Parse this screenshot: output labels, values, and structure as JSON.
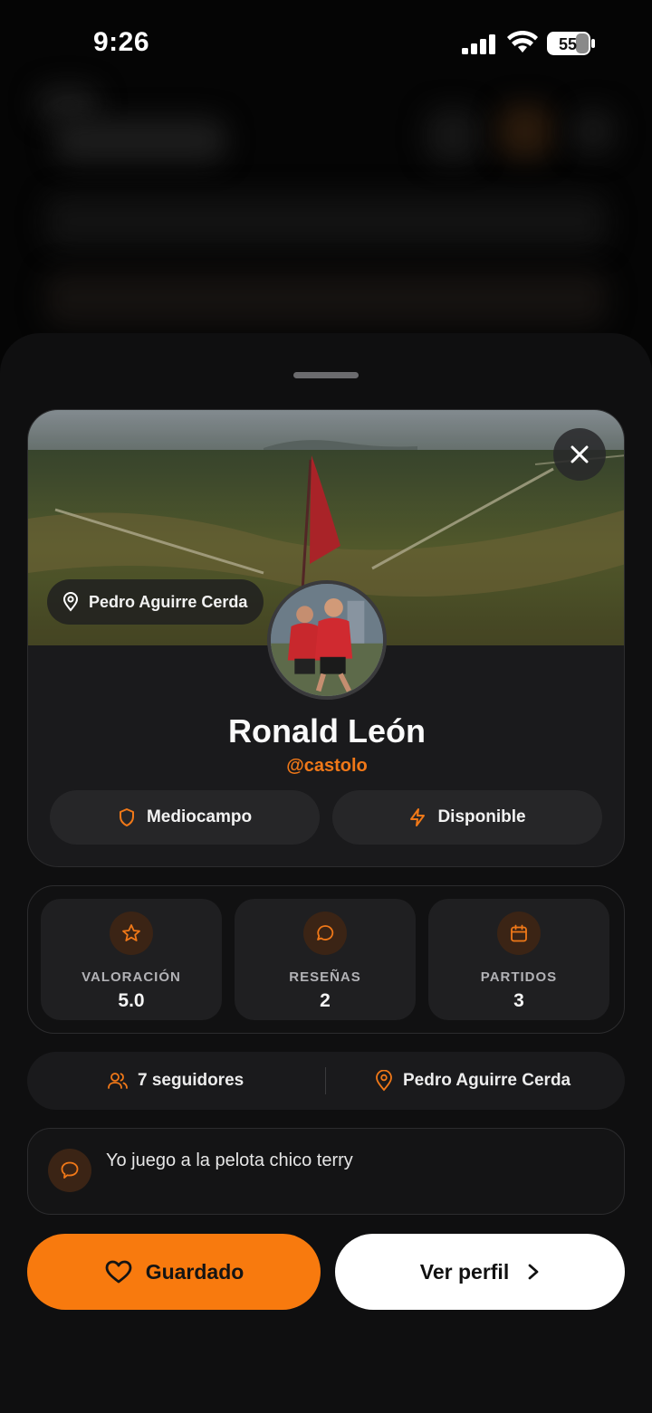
{
  "status_bar": {
    "time": "9:26",
    "battery": "55"
  },
  "colors": {
    "accent": "#f87a0e",
    "sheet_bg": "#0f0f10",
    "card_bg": "#1a1a1c"
  },
  "profile": {
    "location_pill": "Pedro Aguirre Cerda",
    "name": "Ronald León",
    "handle": "@castolo",
    "chips": [
      {
        "icon": "shield-icon",
        "label": "Mediocampo"
      },
      {
        "icon": "lightning-icon",
        "label": "Disponible"
      }
    ]
  },
  "stats": [
    {
      "icon": "star-icon",
      "label": "VALORACIÓN",
      "value": "5.0"
    },
    {
      "icon": "chat-bubble-icon",
      "label": "RESEÑAS",
      "value": "2"
    },
    {
      "icon": "calendar-icon",
      "label": "PARTIDOS",
      "value": "3"
    }
  ],
  "info": {
    "followers": "7 seguidores",
    "location": "Pedro Aguirre Cerda"
  },
  "bio": {
    "text": "Yo juego a la pelota chico terry"
  },
  "actions": {
    "saved_label": "Guardado",
    "profile_label": "Ver perfil"
  }
}
